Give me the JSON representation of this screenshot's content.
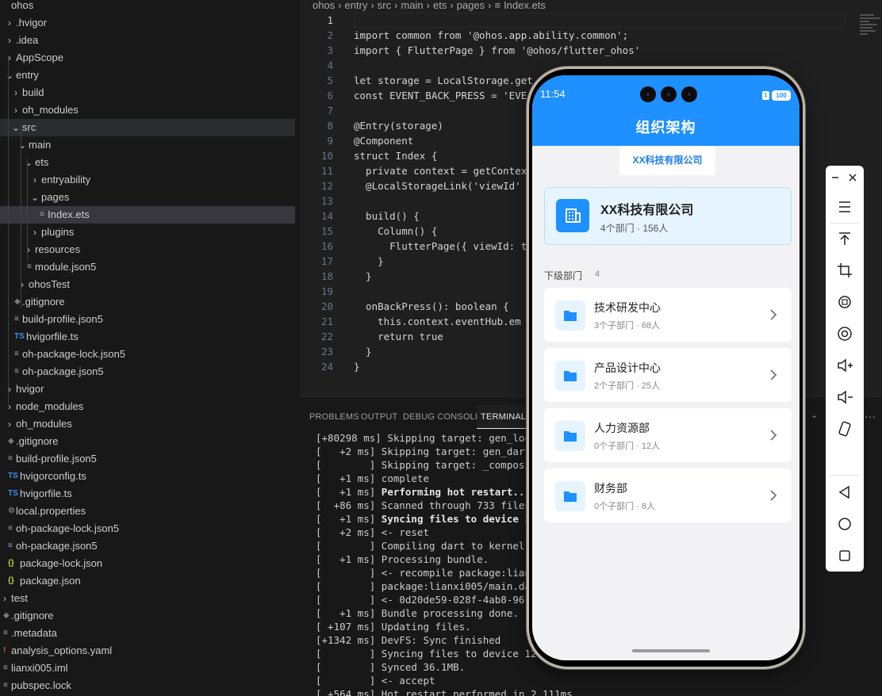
{
  "explorer": {
    "items": [
      {
        "label": "ohos",
        "chevron": "",
        "icon": "",
        "level": -1
      },
      {
        "label": ".hvigor",
        "chevron": "›",
        "icon": "",
        "level": 0
      },
      {
        "label": ".idea",
        "chevron": "›",
        "icon": "",
        "level": 0
      },
      {
        "label": "AppScope",
        "chevron": "›",
        "icon": "",
        "level": 0
      },
      {
        "label": "entry",
        "chevron": "⌄",
        "icon": "",
        "level": 0
      },
      {
        "label": "build",
        "chevron": "›",
        "icon": "",
        "level": 1
      },
      {
        "label": "oh_modules",
        "chevron": "›",
        "icon": "",
        "level": 1
      },
      {
        "label": "src",
        "chevron": "⌄",
        "icon": "",
        "level": 1
      },
      {
        "label": "main",
        "chevron": "⌄",
        "icon": "",
        "level": 2
      },
      {
        "label": "ets",
        "chevron": "⌄",
        "icon": "",
        "level": 3
      },
      {
        "label": "entryability",
        "chevron": "›",
        "icon": "",
        "level": 4
      },
      {
        "label": "pages",
        "chevron": "⌄",
        "icon": "",
        "level": 4
      },
      {
        "label": "Index.ets",
        "chevron": "",
        "icon": "≡",
        "level": 5
      },
      {
        "label": "plugins",
        "chevron": "›",
        "icon": "",
        "level": 4
      },
      {
        "label": "resources",
        "chevron": "›",
        "icon": "",
        "level": 3
      },
      {
        "label": "module.json5",
        "chevron": "",
        "icon": "≡",
        "level": 3
      },
      {
        "label": "ohosTest",
        "chevron": "›",
        "icon": "",
        "level": 2
      },
      {
        "label": ".gitignore",
        "chevron": "",
        "icon": "◆",
        "level": 1
      },
      {
        "label": "build-profile.json5",
        "chevron": "",
        "icon": "≡",
        "level": 1
      },
      {
        "label": "hvigorfile.ts",
        "chevron": "",
        "icon": "TS",
        "level": 1
      },
      {
        "label": "oh-package-lock.json5",
        "chevron": "",
        "icon": "≡",
        "level": 1
      },
      {
        "label": "oh-package.json5",
        "chevron": "",
        "icon": "≡",
        "level": 1
      },
      {
        "label": "hvigor",
        "chevron": "›",
        "icon": "",
        "level": 0
      },
      {
        "label": "node_modules",
        "chevron": "›",
        "icon": "",
        "level": 0
      },
      {
        "label": "oh_modules",
        "chevron": "›",
        "icon": "",
        "level": 0
      },
      {
        "label": ".gitignore",
        "chevron": "",
        "icon": "◆",
        "level": 0
      },
      {
        "label": "build-profile.json5",
        "chevron": "",
        "icon": "≡",
        "level": 0
      },
      {
        "label": "hvigorconfig.ts",
        "chevron": "",
        "icon": "TS",
        "level": 0
      },
      {
        "label": "hvigorfile.ts",
        "chevron": "",
        "icon": "TS",
        "level": 0
      },
      {
        "label": "local.properties",
        "chevron": "",
        "icon": "⚙",
        "level": 0
      },
      {
        "label": "oh-package-lock.json5",
        "chevron": "",
        "icon": "≡",
        "level": 0
      },
      {
        "label": "oh-package.json5",
        "chevron": "",
        "icon": "≡",
        "level": 0
      },
      {
        "label": "package-lock.json",
        "chevron": "",
        "icon": "{}",
        "level": 0
      },
      {
        "label": "package.json",
        "chevron": "",
        "icon": "{}",
        "level": 0
      },
      {
        "label": "test",
        "chevron": "›",
        "icon": "",
        "level": -1
      },
      {
        "label": ".gitignore",
        "chevron": "",
        "icon": "◆",
        "level": -1
      },
      {
        "label": ".metadata",
        "chevron": "",
        "icon": "≡",
        "level": -1
      },
      {
        "label": "analysis_options.yaml",
        "chevron": "",
        "icon": "!",
        "level": -1
      },
      {
        "label": "lianxi005.iml",
        "chevron": "",
        "icon": "≡",
        "level": -1
      },
      {
        "label": "pubspec.lock",
        "chevron": "",
        "icon": "≡",
        "level": -1
      },
      {
        "label": "pubspec.yaml",
        "chevron": "",
        "icon": "!",
        "level": -1
      }
    ]
  },
  "editor": {
    "breadcrumb": [
      "ohos",
      "›",
      "entry",
      "›",
      "src",
      "›",
      "main",
      "›",
      "ets",
      "›",
      "pages",
      "›",
      "≡",
      "Index.ets"
    ],
    "lines": [
      "",
      "import common from '@ohos.app.ability.common';",
      "import { FlutterPage } from '@ohos/flutter_ohos'",
      "",
      "let storage = LocalStorage.get",
      "const EVENT_BACK_PRESS = 'EVE",
      "",
      "@Entry(storage)",
      "@Component",
      "struct Index {",
      "  private context = getContex",
      "  @LocalStorageLink('viewId'",
      "",
      "  build() {",
      "    Column() {",
      "      FlutterPage({ viewId: t",
      "    }",
      "  }",
      "",
      "  onBackPress(): boolean {",
      "    this.context.eventHub.em",
      "    return true",
      "  }",
      "}"
    ],
    "line_numbers": [
      "1",
      "2",
      "3",
      "4",
      "5",
      "6",
      "7",
      "8",
      "9",
      "10",
      "11",
      "12",
      "13",
      "14",
      "15",
      "16",
      "17",
      "18",
      "19",
      "20",
      "21",
      "22",
      "23",
      "24"
    ]
  },
  "panel": {
    "tabs": [
      "PROBLEMS",
      "OUTPUT",
      "DEBUG CONSOLE",
      "TERMINAL"
    ],
    "more": "···",
    "terminal": [
      {
        "prefix": "[+80298 ms] ",
        "bold": "",
        "text": "Skipping target: gen_local"
      },
      {
        "prefix": "[   +2 ms] ",
        "bold": "",
        "text": "Skipping target: gen_dart_p"
      },
      {
        "prefix": "[        ] ",
        "bold": "",
        "text": "Skipping target: _composite"
      },
      {
        "prefix": "[   +1 ms] ",
        "bold": "",
        "text": "complete"
      },
      {
        "prefix": "[   +1 ms] ",
        "bold": "Performing hot restart...",
        "text": ""
      },
      {
        "prefix": "[  +86 ms] ",
        "bold": "",
        "text": "Scanned through 733 files i"
      },
      {
        "prefix": "[   +1 ms] ",
        "bold": "Syncing files to device 127",
        "text": ""
      },
      {
        "prefix": "[   +2 ms] ",
        "bold": "",
        "text": "<- reset"
      },
      {
        "prefix": "[        ] ",
        "bold": "",
        "text": "Compiling dart to kernel wi"
      },
      {
        "prefix": "[   +1 ms] ",
        "bold": "",
        "text": "Processing bundle."
      },
      {
        "prefix": "[        ] ",
        "bold": "",
        "text": "<- recompile package:lianxi"
      },
      {
        "prefix": "[        ] ",
        "bold": "",
        "text": "package:lianxi005/main.dart"
      },
      {
        "prefix": "[        ] ",
        "bold": "",
        "text": "<- 0d20de59-028f-4ab8-961a-"
      },
      {
        "prefix": "[   +1 ms] ",
        "bold": "",
        "text": "Bundle processing done."
      },
      {
        "prefix": "[ +107 ms] ",
        "bold": "",
        "text": "Updating files."
      },
      {
        "prefix": "[+1342 ms] ",
        "bold": "",
        "text": "DevFS: Sync finished"
      },
      {
        "prefix": "[        ] ",
        "bold": "",
        "text": "Syncing files to device 127."
      },
      {
        "prefix": "[        ] ",
        "bold": "",
        "text": "Synced 36.1MB."
      },
      {
        "prefix": "[        ] ",
        "bold": "",
        "text": "<- accept"
      },
      {
        "prefix": "[ +564 ms] ",
        "bold": "",
        "text": "Hot restart performed in 2,111ms."
      }
    ]
  },
  "phone": {
    "time": "11:54",
    "battery": "100",
    "sim": "1",
    "title": "组织架构",
    "breadcrumb": "XX科技有限公司",
    "org": {
      "name": "XX科技有限公司",
      "meta": "4个部门 · 156人"
    },
    "section": {
      "title": "下级部门",
      "count": "4"
    },
    "departments": [
      {
        "name": "技术研发中心",
        "meta": "3个子部门 · 68人"
      },
      {
        "name": "产品设计中心",
        "meta": "2个子部门 · 25人"
      },
      {
        "name": "人力资源部",
        "meta": "0个子部门 · 12人"
      },
      {
        "name": "财务部",
        "meta": "0个子部门 · 8人"
      }
    ]
  },
  "icons": {
    "sidebar": [
      "minimize-icon",
      "close-icon",
      "menu-icon",
      "pin-top-icon",
      "crop-icon",
      "rotate-icon",
      "screenshot-icon",
      "volume-up-icon",
      "volume-down-icon",
      "shake-icon",
      "back-icon",
      "home-icon",
      "recents-icon"
    ]
  },
  "colors": {
    "accent": "#1e90ff",
    "ide_bg": "#1f1f1f",
    "phone_bg": "#f2f2f4"
  }
}
